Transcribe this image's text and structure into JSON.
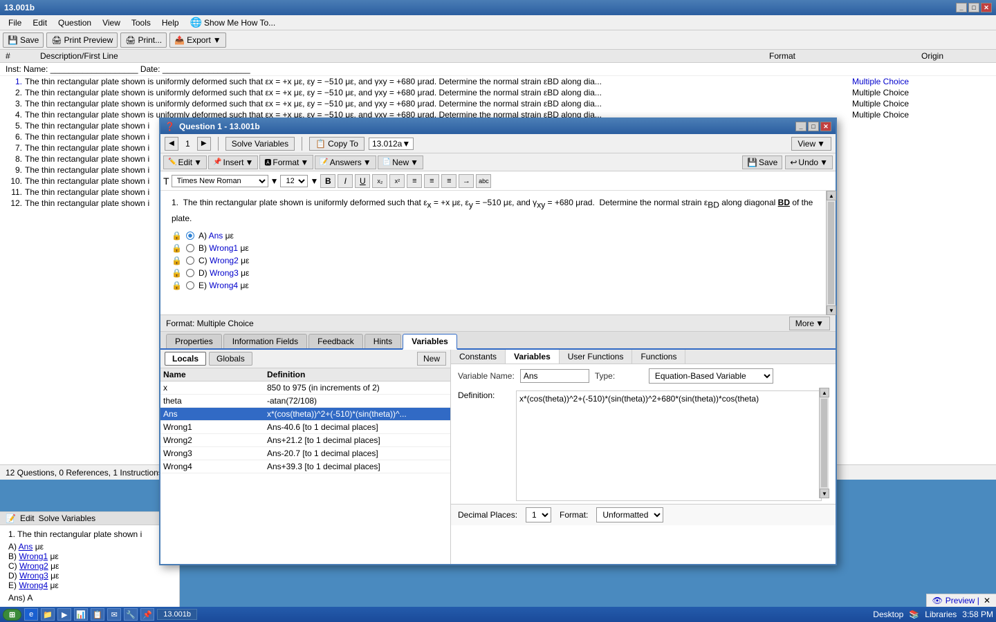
{
  "app": {
    "title": "13.001b",
    "titlebar_controls": [
      "minimize",
      "maximize",
      "close"
    ]
  },
  "menubar": {
    "items": [
      "File",
      "Edit",
      "Question",
      "View",
      "Tools",
      "Help"
    ],
    "show_me": "Show Me How To..."
  },
  "toolbar": {
    "save_label": "Save",
    "print_preview_label": "Print Preview",
    "print_label": "Print...",
    "export_label": "Export"
  },
  "list": {
    "headers": [
      "#",
      "Description/First Line",
      "Format",
      "Origin"
    ],
    "inst_row": "Inst:   Name: ___________________   Date: ___________________",
    "questions": [
      {
        "num": "1.",
        "text": "The thin rectangular plate shown is uniformly deformed such that εx = +x με, εy = −510 με, and γxy = +680 μrad.  Determine the normal strain εBD along dia...",
        "format": "Multiple Choice"
      },
      {
        "num": "2.",
        "text": "The thin rectangular plate shown is uniformly deformed such that εx = +x με, εy = −510 με, and γxy = +680 μrad.  Determine the normal strain εBD along dia...",
        "format": "Multiple Choice"
      },
      {
        "num": "3.",
        "text": "The thin rectangular plate shown is uniformly deformed such that εx = +x με, εy = −510 με, and γxy = +680 μrad.  Determine the normal strain εBD along dia...",
        "format": "Multiple Choice"
      },
      {
        "num": "4.",
        "text": "The thin rectangular plate shown is uniformly deformed such that εx = +x με, εy = −510 με, and γxy = +680 μrad.  Determine the normal strain εBD along dia...",
        "format": "Multiple Choice"
      },
      {
        "num": "5.",
        "text": "The thin rectangular plate shown i",
        "format": ""
      },
      {
        "num": "6.",
        "text": "The thin rectangular plate shown i",
        "format": ""
      },
      {
        "num": "7.",
        "text": "The thin rectangular plate shown i",
        "format": ""
      },
      {
        "num": "8.",
        "text": "The thin rectangular plate shown i",
        "format": ""
      },
      {
        "num": "9.",
        "text": "The thin rectangular plate shown i",
        "format": ""
      },
      {
        "num": "10.",
        "text": "The thin rectangular plate shown i",
        "format": ""
      },
      {
        "num": "11.",
        "text": "The thin rectangular plate shown i",
        "format": ""
      },
      {
        "num": "12.",
        "text": "The thin rectangular plate shown i",
        "format": ""
      }
    ]
  },
  "modal": {
    "title": "Question 1 - 13.001b",
    "nav_num": "1",
    "solve_vars_btn": "Solve Variables",
    "copy_to_btn": "Copy To",
    "copy_to_dest": "13.012a",
    "view_btn": "View",
    "toolbar2": {
      "edit": "Edit",
      "insert": "Insert",
      "format": "Format",
      "answers": "Answers",
      "new": "New",
      "save": "Save",
      "undo": "Undo"
    },
    "font_toolbar": {
      "font_name": "Times New Roman",
      "font_size": "12"
    },
    "question_text": "1.  The thin rectangular plate shown is uniformly deformed such that εx = +x με, εy = −510 με, and γxy = +680 μrad.  Determine the normal strain εBD along diagonal BD of the plate.",
    "options": [
      {
        "letter": "A)",
        "answer": "Ans",
        "unit": "με",
        "correct": true
      },
      {
        "letter": "B)",
        "answer": "Wrong1",
        "unit": "με"
      },
      {
        "letter": "C)",
        "answer": "Wrong2",
        "unit": "με"
      },
      {
        "letter": "D)",
        "answer": "Wrong3",
        "unit": "με"
      },
      {
        "letter": "E)",
        "answer": "Wrong4",
        "unit": "με"
      }
    ],
    "format_label": "Format: Multiple Choice",
    "more_btn": "More",
    "tabs": [
      "Properties",
      "Information Fields",
      "Feedback",
      "Hints",
      "Variables"
    ],
    "active_tab": "Variables"
  },
  "variables_panel": {
    "locals_label": "Locals",
    "globals_label": "Globals",
    "new_btn": "New",
    "columns": [
      "Name",
      "Definition"
    ],
    "rows": [
      {
        "name": "x",
        "definition": "850 to 975 (in increments of 2)"
      },
      {
        "name": "theta",
        "definition": "-atan(72/108)"
      },
      {
        "name": "Ans",
        "definition": "x*(cos(theta))^2+(-510)*(sin(theta))^...",
        "selected": true
      },
      {
        "name": "Wrong1",
        "definition": "Ans-40.6 [to 1 decimal places]"
      },
      {
        "name": "Wrong2",
        "definition": "Ans+21.2 [to 1 decimal places]"
      },
      {
        "name": "Wrong3",
        "definition": "Ans-20.7 [to 1 decimal places]"
      },
      {
        "name": "Wrong4",
        "definition": "Ans+39.3 [to 1 decimal places]"
      }
    ],
    "right_tabs": [
      "Constants",
      "Variables",
      "User Functions",
      "Functions"
    ],
    "active_right_tab": "Variables",
    "detail": {
      "variable_name_label": "Variable Name:",
      "variable_name_value": "Ans",
      "type_label": "Type:",
      "type_value": "Equation-Based Variable",
      "definition_label": "Definition:",
      "definition_value": "x*(cos(theta))^2+(-510)*(sin(theta))^2+680*(sin(theta))*cos(theta)"
    },
    "footer": {
      "decimal_places_label": "Decimal Places:",
      "decimal_places_value": "1",
      "format_label": "Format:",
      "format_value": "Unformatted"
    }
  },
  "bottom_edit": {
    "edit_label": "Edit",
    "solve_vars_label": "Solve Variables",
    "question_text": "1.  The thin rectangular plate shown i",
    "options": [
      {
        "letter": "A)",
        "answer": "Ans",
        "unit": "με"
      },
      {
        "letter": "B)",
        "answer": "Wrong1",
        "unit": "με"
      },
      {
        "letter": "C)",
        "answer": "Wrong2",
        "unit": "με"
      },
      {
        "letter": "D)",
        "answer": "Wrong3",
        "unit": "με"
      },
      {
        "letter": "E)",
        "answer": "Wrong4",
        "unit": "με"
      }
    ],
    "ans_label": "Ans) A"
  },
  "preview_bar": {
    "preview_label": "Preview |"
  },
  "status_bar": {
    "text": "12 Questions, 0 References, 1 Instructions"
  },
  "taskbar": {
    "time": "3:58 PM",
    "desktop_label": "Desktop",
    "libraries_label": "Libraries"
  }
}
